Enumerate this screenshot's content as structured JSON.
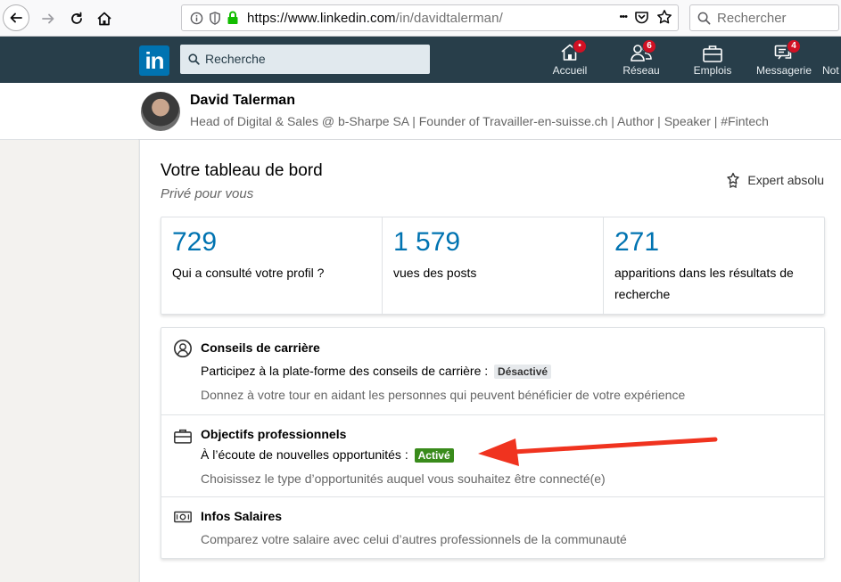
{
  "browser": {
    "url_host": "https://www.linkedin.com",
    "url_path": "/in/davidtalerman/",
    "menu_dots": "•••",
    "search_placeholder": "Rechercher"
  },
  "linkedin_nav": {
    "logo": "in",
    "search_placeholder": "Recherche",
    "items": [
      {
        "label": "Accueil",
        "badge": "•",
        "icon": "home-icon"
      },
      {
        "label": "Réseau",
        "badge": "6",
        "icon": "network-icon"
      },
      {
        "label": "Emplois",
        "badge": "",
        "icon": "briefcase-icon"
      },
      {
        "label": "Messagerie",
        "badge": "4",
        "icon": "messaging-icon"
      },
      {
        "label": "Not",
        "badge": "",
        "icon": "notifications-icon"
      }
    ]
  },
  "profile": {
    "name": "David Talerman",
    "headline": "Head of Digital & Sales @ b-Sharpe SA | Founder of Travailler-en-suisse.ch | Author | Speaker | #Fintech"
  },
  "dashboard": {
    "title": "Votre tableau de bord",
    "subtitle": "Privé pour vous",
    "expert_label": "Expert absolu",
    "stats": [
      {
        "value": "729",
        "label": "Qui a consulté votre profil ?"
      },
      {
        "value": "1 579",
        "label": "vues des posts"
      },
      {
        "value": "271",
        "label": "apparitions dans les résultats de recherche"
      }
    ],
    "features": [
      {
        "title": "Conseils de carrière",
        "line": "Participez à la plate-forme des conseils de carrière :",
        "status": "Désactivé",
        "description": "Donnez à votre tour en aidant les personnes qui peuvent bénéficier de votre expérience",
        "icon": "career-advice-icon"
      },
      {
        "title": "Objectifs professionnels",
        "line": "À l’écoute de nouvelles opportunités :",
        "status": "Activé",
        "description": "Choisissez le type d’opportunités auquel vous souhaitez être connecté(e)",
        "icon": "briefcase-icon"
      },
      {
        "title": "Infos Salaires",
        "description": "Comparez votre salaire avec celui d’autres professionnels de la communauté",
        "icon": "salary-icon"
      }
    ]
  },
  "colors": {
    "linkedin_blue": "#0073b1",
    "nav_bg": "#283e4a",
    "active_green": "#398b1b",
    "arrow_red": "#f0331f"
  }
}
